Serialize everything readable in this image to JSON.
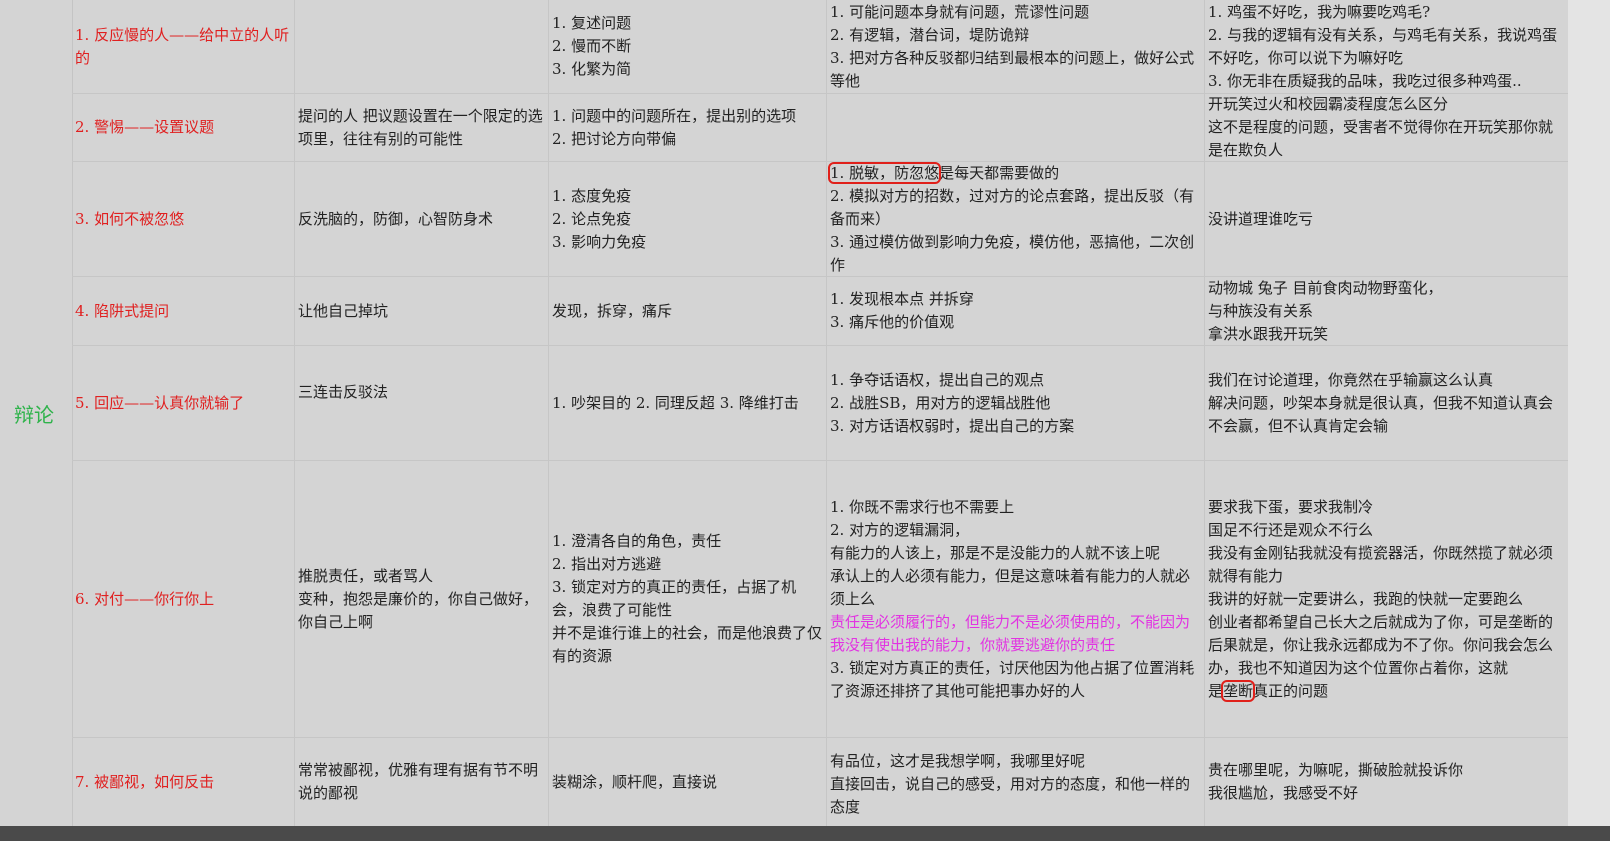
{
  "side_label": "辩论",
  "rows": [
    {
      "title": "1. 反应慢的人——给中立的人听的",
      "desc": "",
      "methods": [
        "1. 复述问题",
        "2. 慢而不断",
        "3. 化繁为简"
      ],
      "points": [
        "1. 可能问题本身就有问题，荒谬性问题",
        "2. 有逻辑，潜台词，堤防诡辩",
        "3. 把对方各种反驳都归结到最根本的问题上，做好公式等他"
      ],
      "examples": [
        "1. 鸡蛋不好吃，我为嘛要吃鸡毛?",
        "2. 与我的逻辑有没有关系，与鸡毛有关系，我说鸡蛋不好吃，你可以说下为嘛好吃",
        "3. 你无非在质疑我的品味，我吃过很多种鸡蛋.."
      ]
    },
    {
      "title": "2. 警惕——设置议题",
      "desc": "提问的人 把议题设置在一个限定的选项里，往往有别的可能性",
      "methods": [
        "1. 问题中的问题所在，提出别的选项",
        "2.  把讨论方向带偏"
      ],
      "points": [],
      "examples": [
        "开玩笑过火和校园霸凌程度怎么区分",
        "这不是程度的问题，受害者不觉得你在开玩笑那你就是在欺负人"
      ]
    },
    {
      "title": "3. 如何不被忽悠",
      "desc": "反洗脑的，防御，心智防身术",
      "methods": [
        "1. 态度免疫",
        "2. 论点免疫",
        "3. 影响力免疫"
      ],
      "points_first_circled": "1. 脱敏，防忽悠",
      "points_first_rest": "是每天都需要做的",
      "points": [
        "2. 模拟对方的招数，过对方的论点套路，提出反驳（有备而来）",
        "3. 通过模仿做到影响力免疫，模仿他，恶搞他，二次创作"
      ],
      "examples": [
        "没讲道理谁吃亏"
      ]
    },
    {
      "title": "4. 陷阱式提问",
      "desc": "让他自己掉坑",
      "methods": [
        "发现，拆穿，痛斥"
      ],
      "points": [
        "1. 发现根本点 并拆穿",
        "3. 痛斥他的价值观"
      ],
      "examples": [
        "动物城 兔子 目前食肉动物野蛮化，",
        "与种族没有关系",
        "拿洪水跟我开玩笑"
      ]
    },
    {
      "title": "5. 回应——认真你就输了",
      "desc": "三连击反驳法",
      "methods": [
        "1. 吵架目的 2. 同理反超 3. 降维打击"
      ],
      "points": [
        "1. 争夺话语权，提出自己的观点",
        "2. 战胜SB，用对方的逻辑战胜他",
        "3. 对方话语权弱时，提出自己的方案"
      ],
      "examples": [
        "我们在讨论道理，你竟然在乎输赢这么认真",
        "解决问题，吵架本身就是很认真，但我不知道认真会不会赢，但不认真肯定会输"
      ]
    },
    {
      "title": "6. 对付——你行你上",
      "desc": [
        "推脱责任，或者骂人",
        "变种，抱怨是廉价的，你自己做好，你自己上啊"
      ],
      "methods": [
        "1. 澄清各自的角色，责任",
        "2. 指出对方逃避",
        "3. 锁定对方的真正的责任，占据了机会，浪费了可能性",
        "并不是谁行谁上的社会，而是他浪费了仅有的资源"
      ],
      "points_before": [
        "1. 你既不需求行也不需要上",
        "2. 对方的逻辑漏洞，",
        "有能力的人该上，那是不是没能力的人就不该上呢",
        "承认上的人必须有能力，但是这意味着有能力的人就必须上么"
      ],
      "points_magenta": "责任是必须履行的，但能力不是必须使用的，不能因为我没有使出我的能力，你就要逃避你的责任",
      "points_after": [
        "3. 锁定对方真正的责任，讨厌他因为他占据了位置消耗了资源还排挤了其他可能把事办好的人"
      ],
      "examples": [
        "要求我下蛋，要求我制冷",
        "国足不行还是观众不行么",
        "我没有金刚钻我就没有揽瓷器活，你既然揽了就必须就得有能力",
        "我讲的好就一定要讲么，我跑的快就一定要跑么",
        "创业者都希望自己长大之后就成为了你，可是垄断的后果就是，你让我永远都成为不了你。你问我会怎么办，我也不知道因为这个位置你占着你，这就"
      ],
      "examples_last_pre": "是",
      "examples_last_circled": "垄断",
      "examples_last_post": "真正的问题"
    },
    {
      "title": "7. 被鄙视，如何反击",
      "desc": "常常被鄙视，优雅有理有据有节不明说的鄙视",
      "methods": [
        "装糊涂，顺杆爬，直接说"
      ],
      "points": [
        "有品位，这才是我想学啊，我哪里好呢",
        "直接回击，说自己的感受，用对方的态度，和他一样的态度"
      ],
      "examples": [
        "贵在哪里呢，为嘛呢，撕破脸就投诉你",
        "我很尴尬，我感受不好"
      ]
    }
  ]
}
